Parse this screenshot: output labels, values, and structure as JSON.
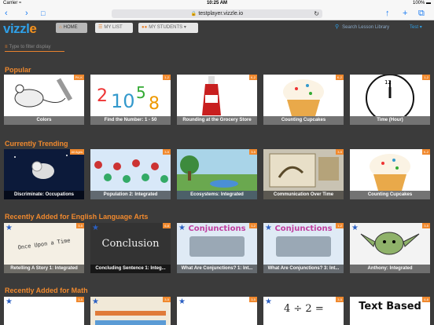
{
  "status": {
    "carrier": "Carrier ≈",
    "time": "10:25 AM",
    "battery": "100% ▬"
  },
  "browser": {
    "back": "‹",
    "forward": "›",
    "bookmarks": "□",
    "url": "testplayer.vizzle.io",
    "lock": "🔒",
    "reload": "↻",
    "share": "↑",
    "new_tab": "+",
    "tabs": "⧉"
  },
  "app": {
    "logo_main": "vizzl",
    "logo_end": "e",
    "nav": {
      "home": "HOME",
      "my_list": "MY LIST",
      "my_students": "MY STUDENTS"
    },
    "search_placeholder": "Search Lesson Library",
    "user": "Test",
    "filter_placeholder": "Type to filter display"
  },
  "sections": [
    {
      "title": "Popular",
      "items": [
        "Colors",
        "Find the Number: 1 - 50",
        "Rounding at the Grocery Store",
        "Counting Cupcakes",
        "Time (Hour)"
      ]
    },
    {
      "title": "Currently Trending",
      "items": [
        "Discriminate: Occupations",
        "Population 2: Integrated",
        "Ecosystems: Integrated",
        "Communication Over Time",
        "Counting Cupcakes"
      ]
    },
    {
      "title": "Recently Added for English Language Arts",
      "items": [
        "Retelling A Story 1: Integrated",
        "Concluding Sentence 1: Integ...",
        "What Are Conjunctions? 1: Int...",
        "What Are Conjunctions? 3: Int...",
        "Anthony: Integrated"
      ]
    },
    {
      "title": "Recently Added for Math",
      "items": [
        "",
        "",
        "",
        "",
        ""
      ]
    }
  ],
  "art_text": {
    "upon": "Once Upon a Time",
    "conclusion": "Conclusion",
    "conj": "Conjunctions",
    "division": "4 ÷ 2 =",
    "textbased": "Text Based"
  }
}
